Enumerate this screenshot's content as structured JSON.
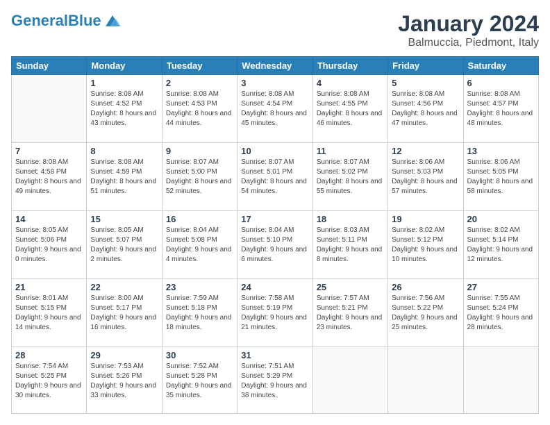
{
  "header": {
    "logo_general": "General",
    "logo_blue": "Blue",
    "month": "January 2024",
    "location": "Balmuccia, Piedmont, Italy"
  },
  "weekdays": [
    "Sunday",
    "Monday",
    "Tuesday",
    "Wednesday",
    "Thursday",
    "Friday",
    "Saturday"
  ],
  "weeks": [
    [
      {
        "day": "",
        "sunrise": "",
        "sunset": "",
        "daylight": ""
      },
      {
        "day": "1",
        "sunrise": "Sunrise: 8:08 AM",
        "sunset": "Sunset: 4:52 PM",
        "daylight": "Daylight: 8 hours and 43 minutes."
      },
      {
        "day": "2",
        "sunrise": "Sunrise: 8:08 AM",
        "sunset": "Sunset: 4:53 PM",
        "daylight": "Daylight: 8 hours and 44 minutes."
      },
      {
        "day": "3",
        "sunrise": "Sunrise: 8:08 AM",
        "sunset": "Sunset: 4:54 PM",
        "daylight": "Daylight: 8 hours and 45 minutes."
      },
      {
        "day": "4",
        "sunrise": "Sunrise: 8:08 AM",
        "sunset": "Sunset: 4:55 PM",
        "daylight": "Daylight: 8 hours and 46 minutes."
      },
      {
        "day": "5",
        "sunrise": "Sunrise: 8:08 AM",
        "sunset": "Sunset: 4:56 PM",
        "daylight": "Daylight: 8 hours and 47 minutes."
      },
      {
        "day": "6",
        "sunrise": "Sunrise: 8:08 AM",
        "sunset": "Sunset: 4:57 PM",
        "daylight": "Daylight: 8 hours and 48 minutes."
      }
    ],
    [
      {
        "day": "7",
        "sunrise": "Sunrise: 8:08 AM",
        "sunset": "Sunset: 4:58 PM",
        "daylight": "Daylight: 8 hours and 49 minutes."
      },
      {
        "day": "8",
        "sunrise": "Sunrise: 8:08 AM",
        "sunset": "Sunset: 4:59 PM",
        "daylight": "Daylight: 8 hours and 51 minutes."
      },
      {
        "day": "9",
        "sunrise": "Sunrise: 8:07 AM",
        "sunset": "Sunset: 5:00 PM",
        "daylight": "Daylight: 8 hours and 52 minutes."
      },
      {
        "day": "10",
        "sunrise": "Sunrise: 8:07 AM",
        "sunset": "Sunset: 5:01 PM",
        "daylight": "Daylight: 8 hours and 54 minutes."
      },
      {
        "day": "11",
        "sunrise": "Sunrise: 8:07 AM",
        "sunset": "Sunset: 5:02 PM",
        "daylight": "Daylight: 8 hours and 55 minutes."
      },
      {
        "day": "12",
        "sunrise": "Sunrise: 8:06 AM",
        "sunset": "Sunset: 5:03 PM",
        "daylight": "Daylight: 8 hours and 57 minutes."
      },
      {
        "day": "13",
        "sunrise": "Sunrise: 8:06 AM",
        "sunset": "Sunset: 5:05 PM",
        "daylight": "Daylight: 8 hours and 58 minutes."
      }
    ],
    [
      {
        "day": "14",
        "sunrise": "Sunrise: 8:05 AM",
        "sunset": "Sunset: 5:06 PM",
        "daylight": "Daylight: 9 hours and 0 minutes."
      },
      {
        "day": "15",
        "sunrise": "Sunrise: 8:05 AM",
        "sunset": "Sunset: 5:07 PM",
        "daylight": "Daylight: 9 hours and 2 minutes."
      },
      {
        "day": "16",
        "sunrise": "Sunrise: 8:04 AM",
        "sunset": "Sunset: 5:08 PM",
        "daylight": "Daylight: 9 hours and 4 minutes."
      },
      {
        "day": "17",
        "sunrise": "Sunrise: 8:04 AM",
        "sunset": "Sunset: 5:10 PM",
        "daylight": "Daylight: 9 hours and 6 minutes."
      },
      {
        "day": "18",
        "sunrise": "Sunrise: 8:03 AM",
        "sunset": "Sunset: 5:11 PM",
        "daylight": "Daylight: 9 hours and 8 minutes."
      },
      {
        "day": "19",
        "sunrise": "Sunrise: 8:02 AM",
        "sunset": "Sunset: 5:12 PM",
        "daylight": "Daylight: 9 hours and 10 minutes."
      },
      {
        "day": "20",
        "sunrise": "Sunrise: 8:02 AM",
        "sunset": "Sunset: 5:14 PM",
        "daylight": "Daylight: 9 hours and 12 minutes."
      }
    ],
    [
      {
        "day": "21",
        "sunrise": "Sunrise: 8:01 AM",
        "sunset": "Sunset: 5:15 PM",
        "daylight": "Daylight: 9 hours and 14 minutes."
      },
      {
        "day": "22",
        "sunrise": "Sunrise: 8:00 AM",
        "sunset": "Sunset: 5:17 PM",
        "daylight": "Daylight: 9 hours and 16 minutes."
      },
      {
        "day": "23",
        "sunrise": "Sunrise: 7:59 AM",
        "sunset": "Sunset: 5:18 PM",
        "daylight": "Daylight: 9 hours and 18 minutes."
      },
      {
        "day": "24",
        "sunrise": "Sunrise: 7:58 AM",
        "sunset": "Sunset: 5:19 PM",
        "daylight": "Daylight: 9 hours and 21 minutes."
      },
      {
        "day": "25",
        "sunrise": "Sunrise: 7:57 AM",
        "sunset": "Sunset: 5:21 PM",
        "daylight": "Daylight: 9 hours and 23 minutes."
      },
      {
        "day": "26",
        "sunrise": "Sunrise: 7:56 AM",
        "sunset": "Sunset: 5:22 PM",
        "daylight": "Daylight: 9 hours and 25 minutes."
      },
      {
        "day": "27",
        "sunrise": "Sunrise: 7:55 AM",
        "sunset": "Sunset: 5:24 PM",
        "daylight": "Daylight: 9 hours and 28 minutes."
      }
    ],
    [
      {
        "day": "28",
        "sunrise": "Sunrise: 7:54 AM",
        "sunset": "Sunset: 5:25 PM",
        "daylight": "Daylight: 9 hours and 30 minutes."
      },
      {
        "day": "29",
        "sunrise": "Sunrise: 7:53 AM",
        "sunset": "Sunset: 5:26 PM",
        "daylight": "Daylight: 9 hours and 33 minutes."
      },
      {
        "day": "30",
        "sunrise": "Sunrise: 7:52 AM",
        "sunset": "Sunset: 5:28 PM",
        "daylight": "Daylight: 9 hours and 35 minutes."
      },
      {
        "day": "31",
        "sunrise": "Sunrise: 7:51 AM",
        "sunset": "Sunset: 5:29 PM",
        "daylight": "Daylight: 9 hours and 38 minutes."
      },
      {
        "day": "",
        "sunrise": "",
        "sunset": "",
        "daylight": ""
      },
      {
        "day": "",
        "sunrise": "",
        "sunset": "",
        "daylight": ""
      },
      {
        "day": "",
        "sunrise": "",
        "sunset": "",
        "daylight": ""
      }
    ]
  ]
}
